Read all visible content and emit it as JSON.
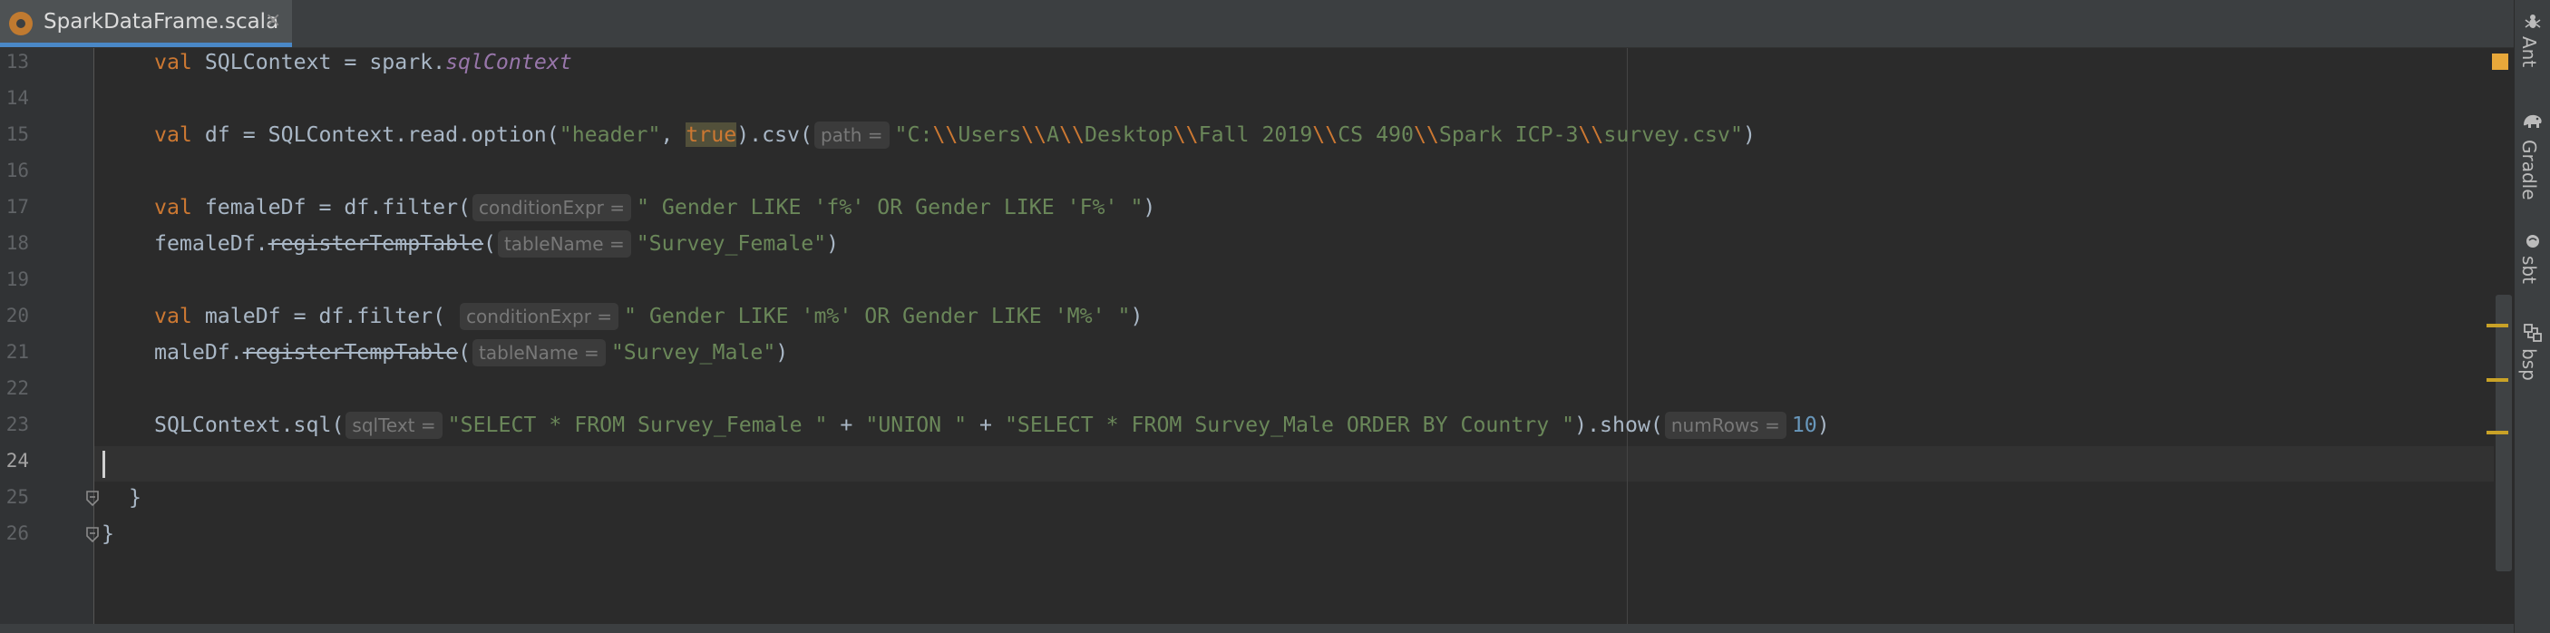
{
  "editor": {
    "tab": {
      "filename": "SparkDataFrame.scala",
      "close_glyph": "×",
      "icon": "scala-file-icon"
    },
    "line_numbers": [
      "13",
      "14",
      "15",
      "16",
      "17",
      "18",
      "19",
      "20",
      "21",
      "22",
      "23",
      "24",
      "25",
      "26"
    ],
    "current_line": "24",
    "lines": {
      "l13": {
        "kw": "val",
        "a": " SQLContext = spark.",
        "b": "sqlContext"
      },
      "l15": {
        "kw": "val",
        "a": " df = SQLContext.read.option(",
        "s1": "\"header\"",
        "c": ", ",
        "kw2": "true",
        "d": ").csv(",
        "hint": "path =",
        "q1": "\"C:",
        "e1": "\\\\",
        "p1": "Users",
        "e2": "\\\\",
        "p2": "A",
        "e3": "\\\\",
        "p3": "Desktop",
        "e4": "\\\\",
        "p4": "Fall 2019",
        "e5": "\\\\",
        "p5": "CS 490",
        "e6": "\\\\",
        "p6": "Spark ICP-3",
        "e7": "\\\\",
        "p7": "survey.csv\"",
        "end": ")"
      },
      "l17": {
        "kw": "val",
        "a": " femaleDf = df.filter(",
        "hint": "conditionExpr =",
        "s": "\" Gender LIKE 'f%' OR Gender LIKE 'F%' \"",
        "end": ")"
      },
      "l18": {
        "a": "femaleDf.",
        "strike": "registerTempTable",
        "b": "(",
        "hint": "tableName =",
        "s": "\"Survey_Female\"",
        "end": ")"
      },
      "l20": {
        "kw": "val",
        "a": " maleDf = df.filter( ",
        "hint": "conditionExpr =",
        "s": "\" Gender LIKE 'm%' OR Gender LIKE 'M%' \"",
        "end": ")"
      },
      "l21": {
        "a": "maleDf.",
        "strike": "registerTempTable",
        "b": "(",
        "hint": "tableName =",
        "s": "\"Survey_Male\"",
        "end": ")"
      },
      "l23": {
        "a": "SQLContext.sql(",
        "hint": "sqlText =",
        "s1": "\"SELECT * FROM Survey_Female \"",
        "c1": " + ",
        "s2": "\"UNION \"",
        "c2": " + ",
        "s3": "\"SELECT * FROM Survey_Male ORDER BY Country \"",
        "d": ").show(",
        "hint2": "numRows =",
        "n": "10",
        "end": ")"
      },
      "l25": {
        "a": "}"
      },
      "l26": {
        "a": "}"
      }
    }
  },
  "tool_windows": [
    {
      "label": "Ant",
      "icon": "ant-icon"
    },
    {
      "label": "Gradle",
      "icon": "gradle-elephant-icon"
    },
    {
      "label": "sbt",
      "icon": "sbt-icon"
    },
    {
      "label": "bsp",
      "icon": "bsp-icon"
    }
  ],
  "colors": {
    "keyword": "#cc7832",
    "string": "#6a8759",
    "number": "#6897bb",
    "field": "#9876aa",
    "text": "#a9b7c6",
    "background": "#2b2b2b",
    "tab_accent": "#4a88c7",
    "warning": "#e8a83a"
  }
}
